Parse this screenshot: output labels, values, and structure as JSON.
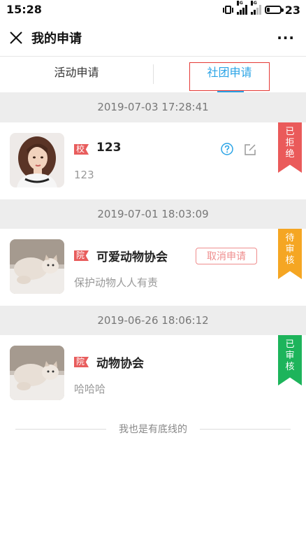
{
  "status_bar": {
    "time": "15:28",
    "net_1": "3G",
    "net_2": "4G",
    "battery": "23",
    "battery_fraction": 0.23
  },
  "header": {
    "title": "我的申请",
    "more_label": "···"
  },
  "tabs": [
    {
      "label": "活动申请",
      "active": false
    },
    {
      "label": "社团申请",
      "active": true
    }
  ],
  "applications": [
    {
      "date": "2019-07-03 17:28:41",
      "tag": "校",
      "title": "123",
      "description": "123",
      "status": [
        "已",
        "拒",
        "绝"
      ],
      "status_color": "#ea5a5a",
      "avatar": "woman-portrait"
    },
    {
      "date": "2019-07-01 18:03:09",
      "tag": "院",
      "title": "可爱动物协会",
      "description": "保护动物人人有责",
      "status": [
        "待",
        "审",
        "核"
      ],
      "status_color": "#f5a623",
      "action": "取消申请",
      "avatar": "cat-photo"
    },
    {
      "date": "2019-06-26 18:06:12",
      "tag": "院",
      "title": "动物协会",
      "description": "哈哈哈",
      "status": [
        "已",
        "审",
        "核"
      ],
      "status_color": "#1db45b",
      "avatar": "cat-photo"
    }
  ],
  "footer": {
    "text": "我也是有底线的"
  },
  "colors": {
    "accent": "#29a3e6",
    "highlight_box": "#e53935",
    "tag_red": "#e85d5d"
  }
}
